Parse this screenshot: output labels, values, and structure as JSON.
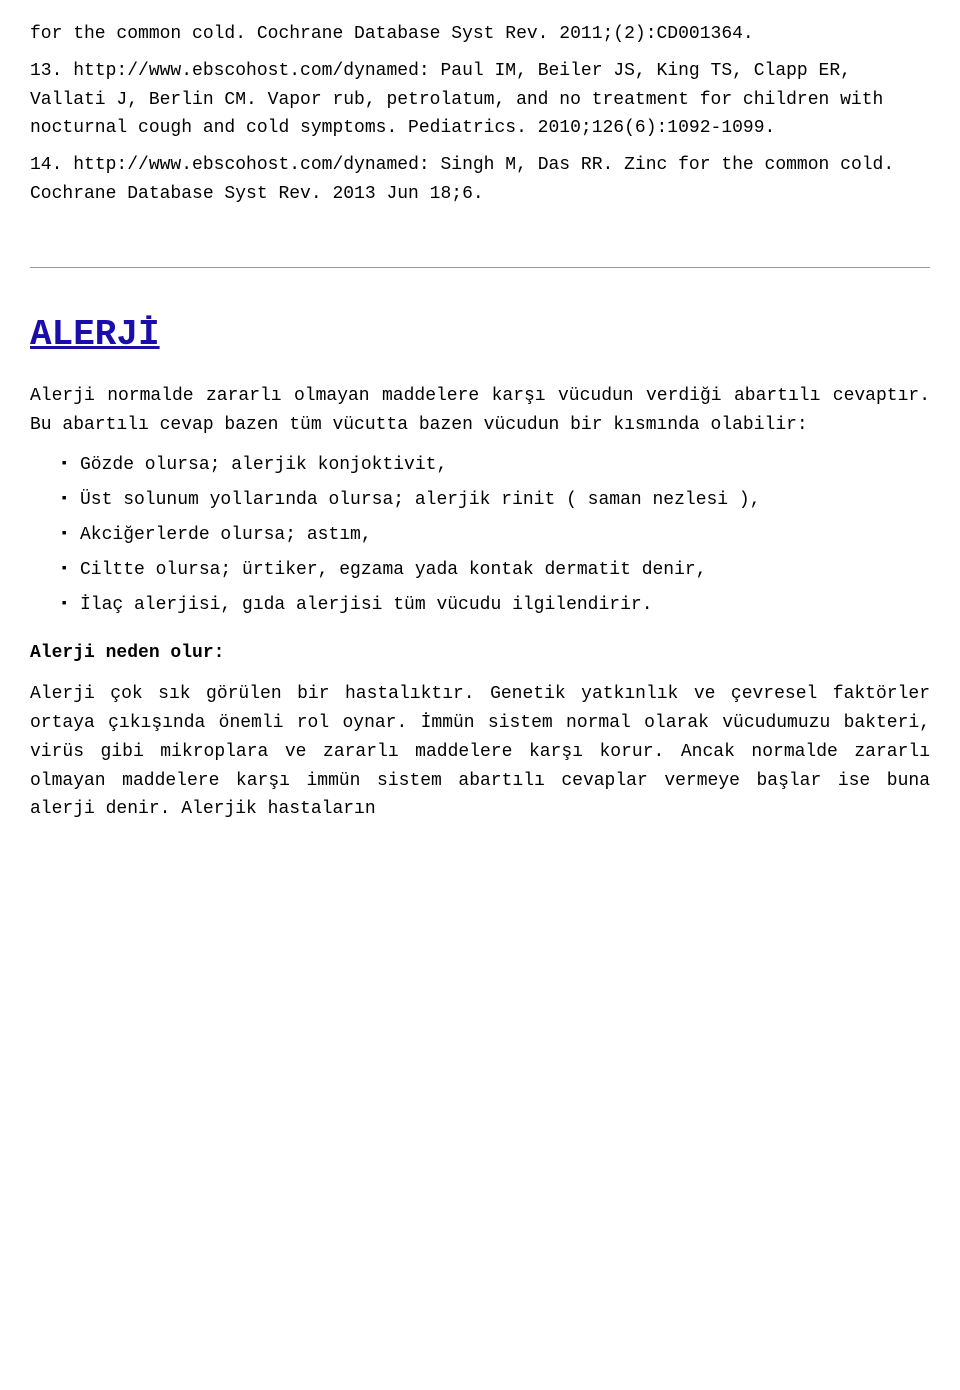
{
  "references": {
    "ref12_text": "for the common cold. Cochrane Database Syst Rev. 2011;(2):CD001364.",
    "ref13_label": "13.",
    "ref13_text": "http://www.ebscohost.com/dynamed: Paul IM, Beiler JS, King TS, Clapp ER, Vallati J, Berlin CM. Vapor rub, petrolatum, and no treatment for children with nocturnal cough and cold symptoms. Pediatrics. 2010;126(6):1092-1099.",
    "ref14_label": "14.",
    "ref14_text": "http://www.ebscohost.com/dynamed: Singh M, Das RR. Zinc for the common cold. Cochrane Database Syst Rev. 2013 Jun 18;6."
  },
  "alerji": {
    "title": "ALERJİ",
    "intro1": "Alerji normalde zararlı olmayan maddelere karşı vücudun verdiği abartılı cevaptır. Bu abartılı cevap bazen tüm vücutta bazen vücudun bir kısmında olabilir:",
    "list_items": [
      "Gözde olursa; alerjik konjoktivit,",
      "Üst solunum yollarında olursa; alerjik rinit ( saman nezlesi ),",
      "Akciğerlerde olursa; astım,",
      "Ciltte olursa; ürtiker, egzama yada kontak dermatit denir,",
      "İlaç alerjisi, gıda alerjisi tüm vücudu ilgilendirir."
    ],
    "subsection_title": "Alerji neden olur:",
    "para1": "Alerji çok sık görülen bir hastalıktır. Genetik yatkınlık ve çevresel faktörler ortaya çıkışında önemli rol oynar. İmmün sistem normal olarak vücudumuzu bakteri, virüs gibi mikroplara ve zararlı maddelere karşı korur. Ancak normalde zararlı olmayan maddelere karşı immün sistem abartılı cevaplar vermeye başlar ise buna alerji denir. Alerjik hastaların"
  }
}
